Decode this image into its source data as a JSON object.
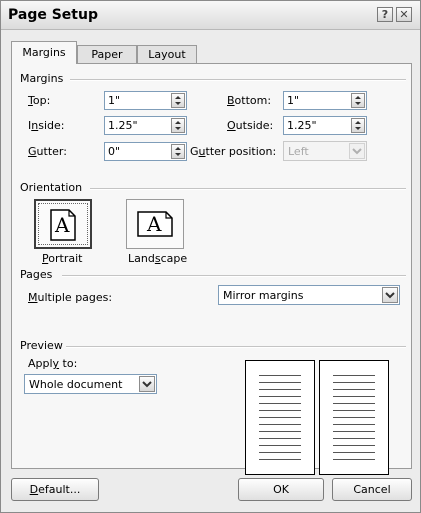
{
  "window": {
    "title": "Page Setup",
    "help_glyph": "?",
    "close_glyph": "✕"
  },
  "tabs": [
    {
      "label": "Margins",
      "active": true
    },
    {
      "label": "Paper",
      "active": false
    },
    {
      "label": "Layout",
      "active": false
    }
  ],
  "margins": {
    "heading": "Margins",
    "top": {
      "pre": "",
      "key": "T",
      "post": "op:",
      "value": "1\""
    },
    "bottom": {
      "pre": "",
      "key": "B",
      "post": "ottom:",
      "value": "1\""
    },
    "inside": {
      "pre": "I",
      "key": "n",
      "post": "side:",
      "value": "1.25\""
    },
    "outside": {
      "pre": "",
      "key": "O",
      "post": "utside:",
      "value": "1.25\""
    },
    "gutter": {
      "pre": "",
      "key": "G",
      "post": "utter:",
      "value": "0\""
    },
    "gutter_position": {
      "pre": "G",
      "key": "u",
      "post": "tter position:",
      "value": "Left"
    }
  },
  "orientation": {
    "heading": "Orientation",
    "glyph": "A",
    "portrait": {
      "pre": "",
      "key": "P",
      "post": "ortrait"
    },
    "landscape": {
      "pre": "Land",
      "key": "s",
      "post": "cape"
    }
  },
  "pages": {
    "heading": "Pages",
    "multiple_pages": {
      "pre": "",
      "key": "M",
      "post": "ultiple pages:"
    },
    "multiple_pages_value": "Mirror margins"
  },
  "preview": {
    "heading": "Preview",
    "apply_to": {
      "pre": "Appl",
      "key": "y",
      "post": " to:"
    },
    "apply_to_value": "Whole document"
  },
  "buttons": {
    "default": {
      "pre": "",
      "key": "D",
      "post": "efault..."
    },
    "ok": "OK",
    "cancel": "Cancel"
  }
}
